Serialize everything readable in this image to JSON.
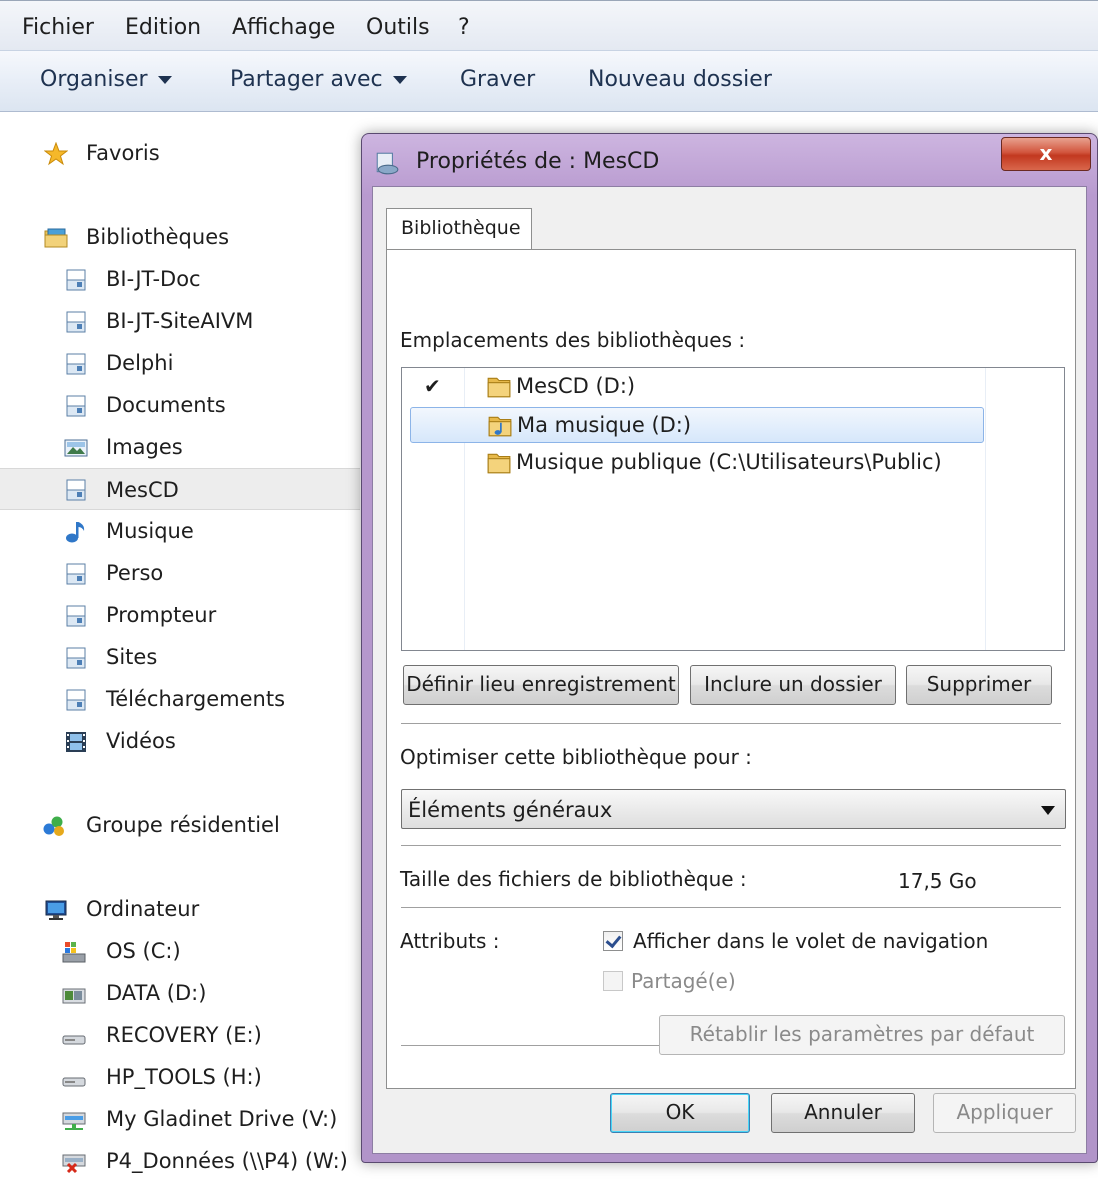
{
  "menubar": {
    "items": [
      "Fichier",
      "Edition",
      "Affichage",
      "Outils",
      "?"
    ]
  },
  "toolbar": {
    "organize": "Organiser",
    "share": "Partager avec",
    "burn": "Graver",
    "new_folder": "Nouveau dossier"
  },
  "nav": {
    "favorites": "Favoris",
    "libraries": "Bibliothèques",
    "library_items": [
      "BI-JT-Doc",
      "BI-JT-SiteAIVM",
      "Delphi",
      "Documents",
      "Images",
      "MesCD",
      "Musique",
      "Perso",
      "Prompteur",
      "Sites",
      "Téléchargements",
      "Vidéos"
    ],
    "homegroup": "Groupe résidentiel",
    "computer": "Ordinateur",
    "drives": [
      "OS (C:)",
      "DATA (D:)",
      "RECOVERY (E:)",
      "HP_TOOLS (H:)",
      "My Gladinet Drive (V:)",
      "P4_Données (\\\\P4) (W:)"
    ]
  },
  "dialog": {
    "title": "Propriétés de : MesCD",
    "close": "x",
    "tab": "Bibliothèque",
    "locations_label": "Emplacements des bibliothèques :",
    "locations": [
      {
        "check": "✔",
        "name": "MesCD (D:)"
      },
      {
        "check": "",
        "name": "Ma musique (D:)"
      },
      {
        "check": "",
        "name": "Musique publique (C:\\Utilisateurs\\Public)"
      }
    ],
    "btn_set_save": "Définir lieu enregistrement",
    "btn_include": "Inclure un dossier",
    "btn_remove": "Supprimer",
    "optimize_label": "Optimiser cette bibliothèque pour :",
    "optimize_value": "Éléments généraux",
    "size_label": "Taille des fichiers de bibliothèque :",
    "size_value": "17,5 Go",
    "attributes_label": "Attributs :",
    "attr_show_nav": "Afficher dans le volet de navigation",
    "attr_shared": "Partagé(e)",
    "btn_restore": "Rétablir les paramètres par défaut",
    "btn_ok": "OK",
    "btn_cancel": "Annuler",
    "btn_apply": "Appliquer"
  }
}
